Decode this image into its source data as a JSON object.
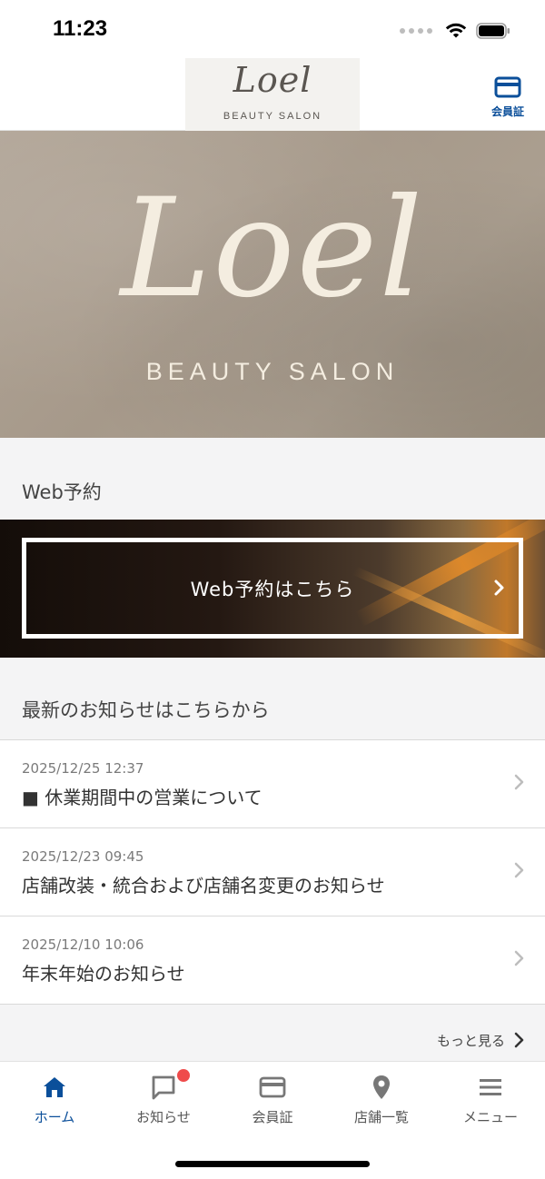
{
  "status_bar": {
    "time": "11:23"
  },
  "header": {
    "logo_script": "Loel",
    "logo_sub": "BEAUTY SALON",
    "member_card_label": "会員証"
  },
  "hero": {
    "script": "Loel",
    "sub": "BEAUTY SALON"
  },
  "web_reserve": {
    "section_title": "Web予約",
    "button_label": "Web予約はこちら"
  },
  "news": {
    "section_title": "最新のお知らせはこちらから",
    "items": [
      {
        "date": "2025/12/25 12:37",
        "title": "■ 休業期間中の営業について"
      },
      {
        "date": "2025/12/23 09:45",
        "title": "店舗改装・統合および店舗名変更のお知らせ"
      },
      {
        "date": "2025/12/10 10:06",
        "title": "年末年始のお知らせ"
      }
    ],
    "more_label": "もっと見る"
  },
  "tab_bar": {
    "tabs": [
      {
        "label": "ホーム",
        "icon": "home-icon",
        "active": true
      },
      {
        "label": "お知らせ",
        "icon": "chat-icon",
        "badge": true
      },
      {
        "label": "会員証",
        "icon": "card-icon"
      },
      {
        "label": "店舗一覧",
        "icon": "location-pin-icon"
      },
      {
        "label": "メニュー",
        "icon": "hamburger-menu-icon"
      }
    ]
  },
  "colors": {
    "accent": "#0b4f9a",
    "badge": "#ef4b4b",
    "icon_gray": "#777777"
  }
}
